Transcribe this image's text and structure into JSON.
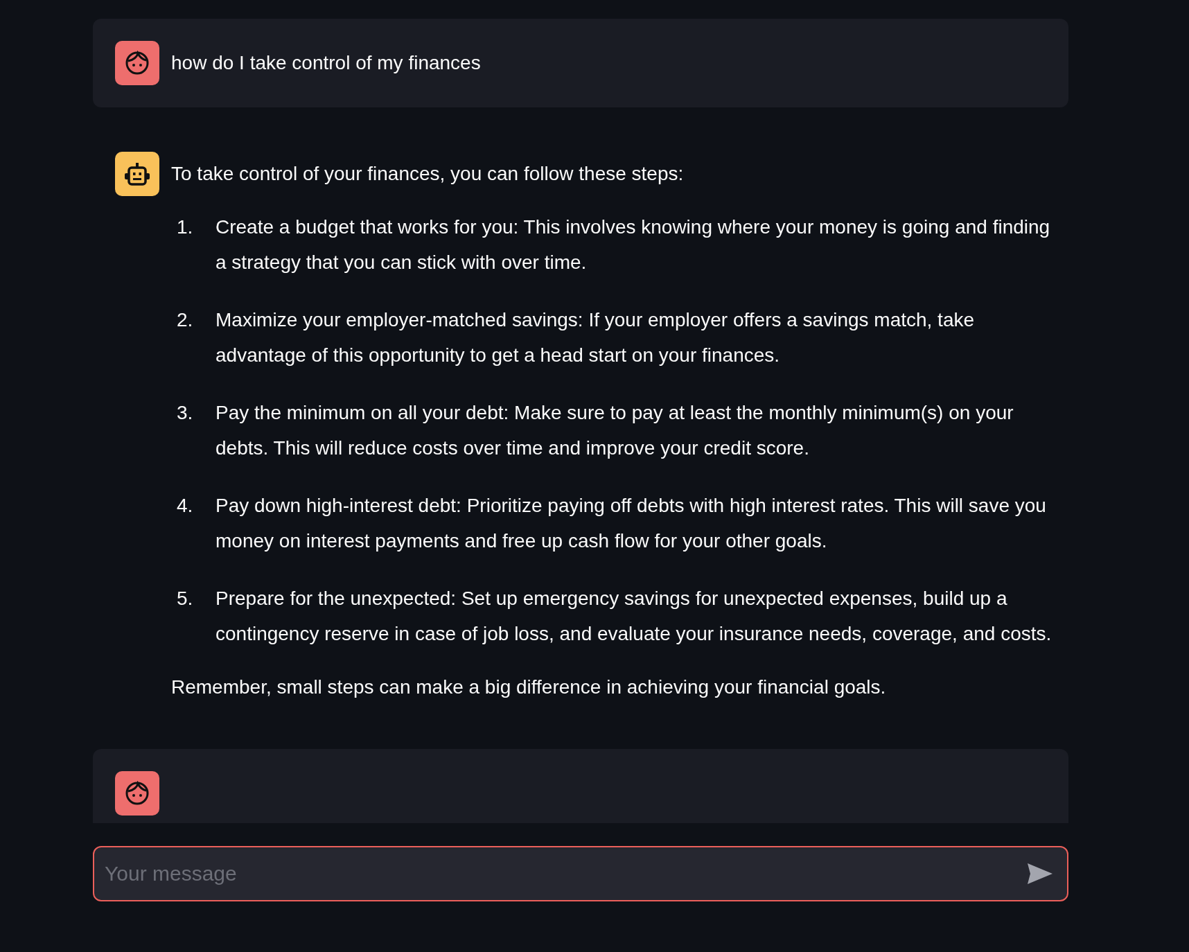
{
  "messages": [
    {
      "kind": "user",
      "text": "how do I take control of my finances"
    },
    {
      "kind": "assistant",
      "intro": "To take control of your finances, you can follow these steps:",
      "steps": [
        {
          "number": "1.",
          "text": "Create a budget that works for you: This involves knowing where your money is going and finding a strategy that you can stick with over time."
        },
        {
          "number": "2.",
          "text": "Maximize your employer-matched savings: If your employer offers a savings match, take advantage of this opportunity to get a head start on your finances."
        },
        {
          "number": "3.",
          "text": "Pay the minimum on all your debt: Make sure to pay at least the monthly minimum(s) on your debts. This will reduce costs over time and improve your credit score."
        },
        {
          "number": "4.",
          "text": "Pay down high-interest debt: Prioritize paying off debts with high interest rates. This will save you money on interest payments and free up cash flow for your other goals."
        },
        {
          "number": "5.",
          "text": "Prepare for the unexpected: Set up emergency savings for unexpected expenses, build up a contingency reserve in case of job loss, and evaluate your insurance needs, coverage, and costs."
        }
      ],
      "closing": "Remember, small steps can make a big difference in achieving your financial goals."
    },
    {
      "kind": "user"
    }
  ],
  "input": {
    "placeholder": "Your message"
  }
}
